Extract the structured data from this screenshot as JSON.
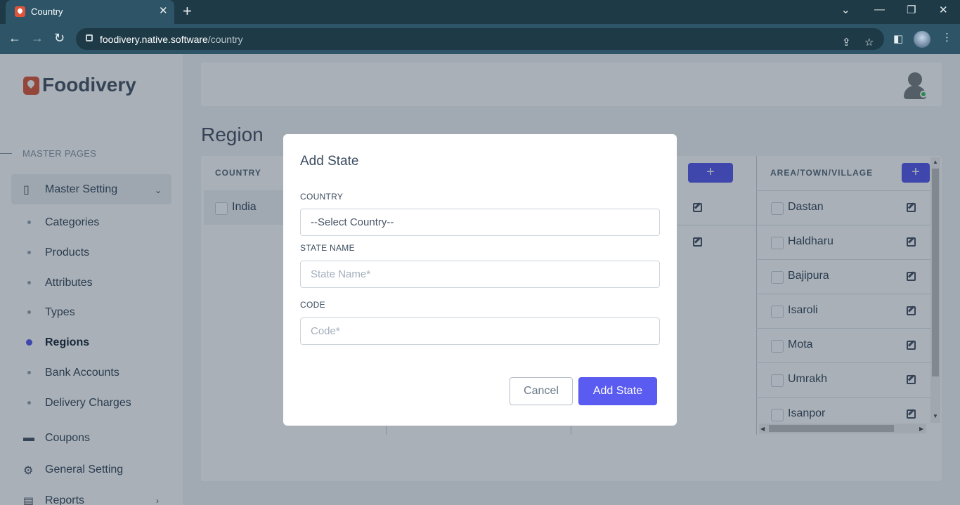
{
  "browser": {
    "tab_title": "Country",
    "url_domain": "foodivery.native.software",
    "url_path": "/country",
    "icons": [
      "back-icon",
      "forward-icon",
      "reload-icon",
      "lock-icon",
      "share-icon",
      "star-icon",
      "sidepanel-icon",
      "profile-avatar",
      "menu-icon"
    ]
  },
  "sidebar": {
    "brand": "Foodivery",
    "section_label": "MASTER PAGES",
    "master_setting": "Master Setting",
    "sub_items": [
      "Categories",
      "Products",
      "Attributes",
      "Types",
      "Regions",
      "Bank Accounts",
      "Delivery Charges"
    ],
    "active_item": "Regions",
    "bottom_items": [
      "Coupons",
      "General Setting",
      "Reports"
    ]
  },
  "page": {
    "title": "Region",
    "columns": {
      "country": "COUNTRY",
      "area": "AREA/TOWN/VILLAGE"
    },
    "add_symbol": "+",
    "countries": [
      "India"
    ],
    "areas": [
      "Dastan",
      "Haldharu",
      "Bajipura",
      "Isaroli",
      "Mota",
      "Umrakh",
      "Isanpor"
    ]
  },
  "modal": {
    "title": "Add State",
    "country_label": "COUNTRY",
    "country_value": "--Select Country--",
    "state_label": "STATE NAME",
    "state_placeholder": "State Name*",
    "code_label": "CODE",
    "code_placeholder": "Code*",
    "cancel": "Cancel",
    "submit": "Add State"
  },
  "colors": {
    "accent": "#5a5bf0",
    "brand": "#e05a3d",
    "chrome": "#2d5567",
    "online": "#3bc45a"
  }
}
